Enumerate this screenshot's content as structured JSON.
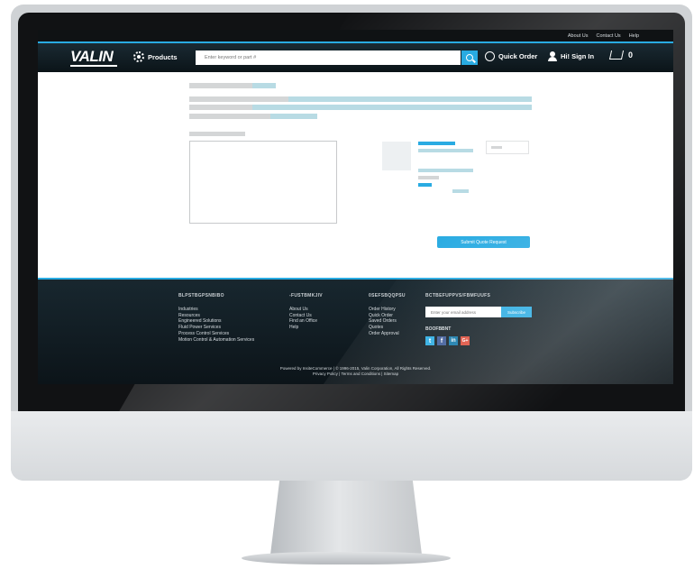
{
  "utility": {
    "about": "About Us",
    "contact": "Contact Us",
    "help": "Help"
  },
  "header": {
    "logo": "VALIN",
    "products_label": "Products",
    "search_placeholder": "Enter keyword or part #",
    "quick_order_label": "Quick Order",
    "signin_label": "Hi! Sign In",
    "cart_count": "0"
  },
  "form": {
    "submit_label": "Submit Quote Request"
  },
  "footer": {
    "col1_heading": "BLPSTBGPSNBIBO",
    "col1_links": [
      "Industries",
      "Resources",
      "Engineered Solutions",
      "Fluid Power Services",
      "Process Control Services",
      "Motion Control & Automation Services"
    ],
    "col2_heading": "-FUSTBMKJIV",
    "col2_links": [
      "About Us",
      "Contact Us",
      "Find an Office",
      "Help"
    ],
    "col3_heading": "0SEFSBQQPSU",
    "col3_links": [
      "Order History",
      "Quick Order",
      "Saved Orders",
      "Quotes",
      "Order Approval"
    ],
    "col4_heading": "BCTBEFUPPVS/FBMFUUFS",
    "email_placeholder": "Enter your email address",
    "subscribe_label": "Subscribe",
    "social_heading": "BOOFBBNT",
    "social": {
      "twitter": "t",
      "facebook": "f",
      "linkedin": "in",
      "google": "G+"
    },
    "copyright_line1": "Powered by InsiteCommerce | © 1996-2015, Valin Corporation, All Rights Reserved.",
    "copyright_line2": "Privacy Policy | Terms and Conditions | Sitemap"
  },
  "colors": {
    "accent": "#29abe2",
    "header_bg": "#0f1a1f"
  }
}
